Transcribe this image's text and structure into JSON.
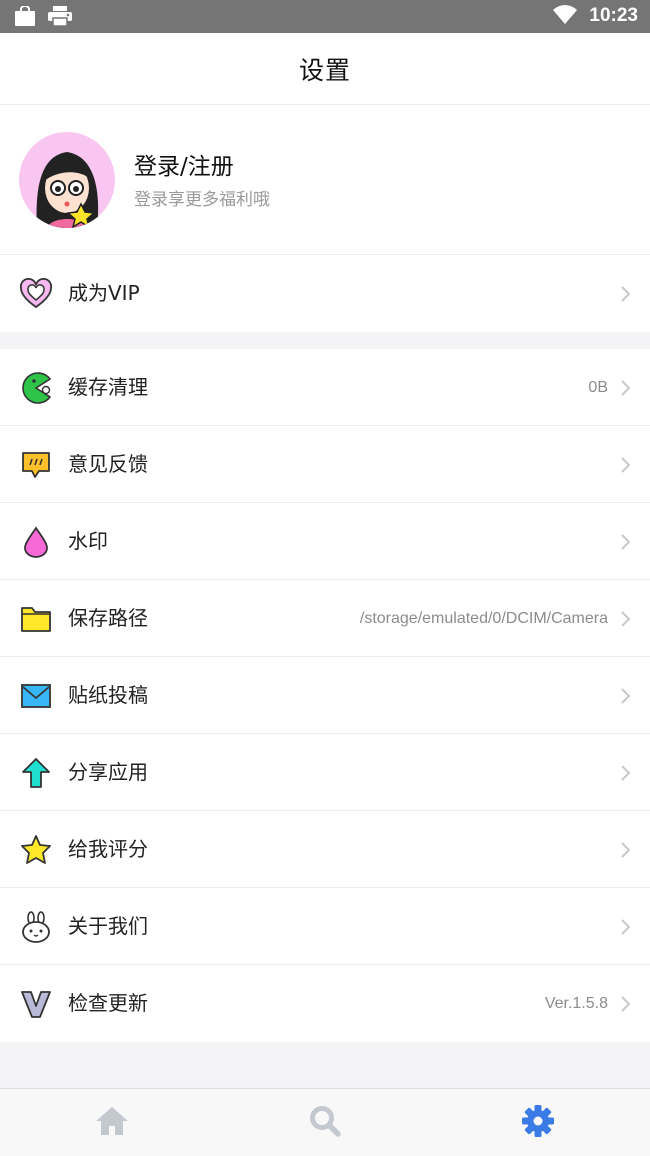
{
  "status_bar": {
    "time": "10:23",
    "icons": [
      "bag-icon",
      "printer-icon",
      "wifi-icon"
    ]
  },
  "header": {
    "title": "设置"
  },
  "profile": {
    "name": "登录/注册",
    "subtitle": "登录享更多福利哦",
    "avatar": "cartoon-girl-avatar"
  },
  "vip": {
    "label": "成为VIP",
    "icon": "heart-icon"
  },
  "settings": [
    {
      "label": "缓存清理",
      "value": "0B",
      "icon": "pacman-icon"
    },
    {
      "label": "意见反馈",
      "value": "",
      "icon": "feedback-bubble-icon"
    },
    {
      "label": "水印",
      "value": "",
      "icon": "drop-icon"
    },
    {
      "label": "保存路径",
      "value": "/storage/emulated/0/DCIM/Camera",
      "icon": "folder-icon"
    },
    {
      "label": "贴纸投稿",
      "value": "",
      "icon": "mail-icon"
    },
    {
      "label": "分享应用",
      "value": "",
      "icon": "share-arrow-icon"
    },
    {
      "label": "给我评分",
      "value": "",
      "icon": "star-icon"
    },
    {
      "label": "关于我们",
      "value": "",
      "icon": "bunny-icon"
    },
    {
      "label": "检查更新",
      "value": "Ver.1.5.8",
      "icon": "v-logo-icon"
    }
  ],
  "tabs": [
    {
      "name": "home",
      "icon": "home-icon",
      "active": false
    },
    {
      "name": "search",
      "icon": "search-icon",
      "active": false
    },
    {
      "name": "settings",
      "icon": "gear-icon",
      "active": true
    }
  ],
  "colors": {
    "accent": "#3b7be6",
    "tab_inactive": "#c4c8cf",
    "status_bar": "#757575"
  }
}
